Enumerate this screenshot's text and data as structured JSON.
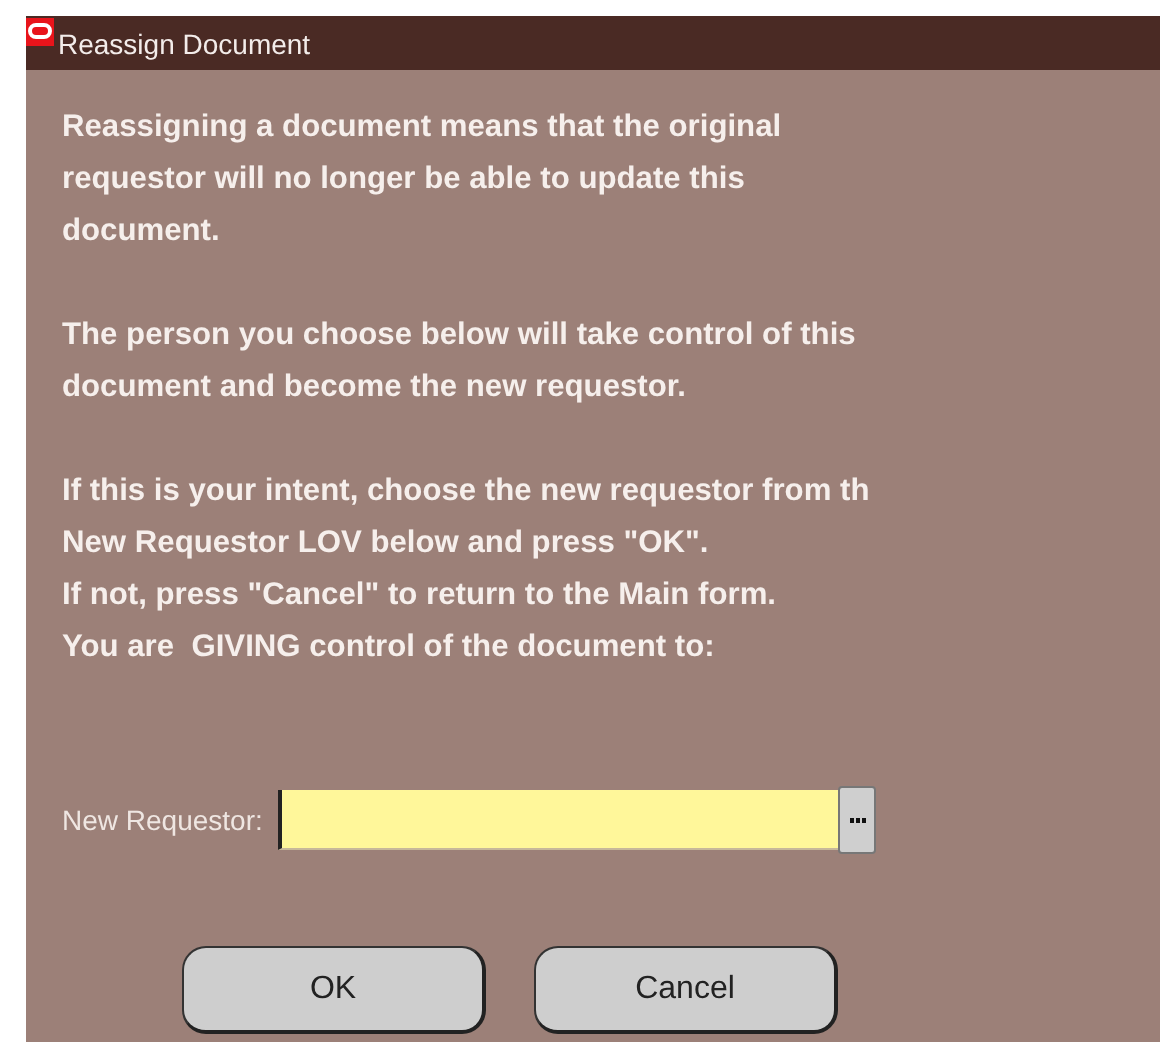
{
  "window": {
    "title": "Reassign Document"
  },
  "paragraphs": [
    [
      "Reassigning a document means that the original",
      "requestor will no longer be able to update this",
      "document."
    ],
    [
      "The person you choose below will take control of this",
      "document and become the new requestor."
    ],
    [
      "If this is your intent, choose the new requestor from th",
      "New Requestor LOV below and press \"OK\".",
      "If not, press \"Cancel\" to return to the Main form.",
      "You are  GIVING control of the document to:"
    ]
  ],
  "field": {
    "label": "New Requestor:"
  },
  "buttons": [
    "OK",
    "Cancel"
  ]
}
